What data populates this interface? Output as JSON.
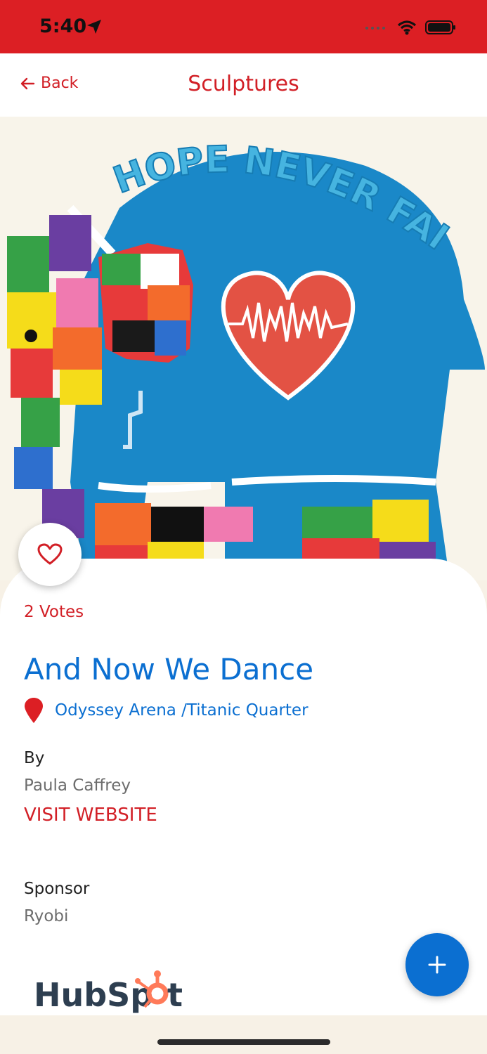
{
  "status_bar": {
    "time": "5:40",
    "icons": [
      "location-arrow-icon",
      "signal-icon",
      "wifi-icon",
      "battery-icon"
    ]
  },
  "nav": {
    "back_label": "Back",
    "title": "Sculptures"
  },
  "hero": {
    "image_text": "HOPE NEVER FAILS"
  },
  "sculpture": {
    "votes": "2 Votes",
    "title": "And Now We Dance",
    "location": "Odyssey Arena /Titanic Quarter",
    "by_label": "By",
    "artist": "Paula Caffrey",
    "visit_label": "VISIT WEBSITE",
    "sponsor_label": "Sponsor",
    "sponsor": "Ryobi"
  },
  "logo": {
    "text_part1": "HubSp",
    "text_part2": "t"
  },
  "colors": {
    "brand_red": "#dc1f24",
    "accent_blue": "#0b6fd1",
    "hubspot_orange": "#ff7a59"
  }
}
